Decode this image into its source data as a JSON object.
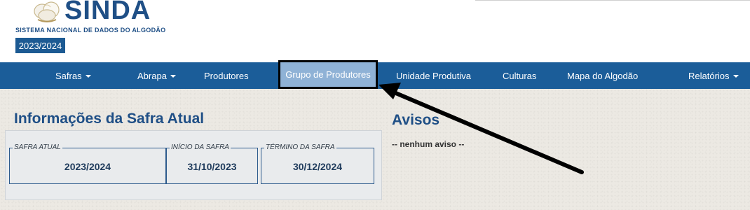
{
  "header": {
    "logo_name": "SINDA",
    "logo_tagline": "SISTEMA NACIONAL DE DADOS DO ALGODÃO",
    "safra_badge": "2023/2024"
  },
  "nav": {
    "items": [
      {
        "label": "Safras",
        "has_caret": true
      },
      {
        "label": "Abrapa",
        "has_caret": true
      },
      {
        "label": "Produtores",
        "has_caret": false
      },
      {
        "label": "Grupo de Produtores",
        "has_caret": false,
        "highlighted": true
      },
      {
        "label": "Unidade Produtiva",
        "has_caret": false
      },
      {
        "label": "Culturas",
        "has_caret": false
      },
      {
        "label": "Mapa do Algodão",
        "has_caret": false
      },
      {
        "label": "Relatórios",
        "has_caret": true
      }
    ]
  },
  "safra_info": {
    "title": "Informações da Safra Atual",
    "fields": [
      {
        "legend": "SAFRA ATUAL",
        "value": "2023/2024"
      },
      {
        "legend": "INÍCIO DA SAFRA",
        "value": "31/10/2023"
      },
      {
        "legend": "TÉRMINO DA SAFRA",
        "value": "30/12/2024"
      }
    ]
  },
  "avisos": {
    "title": "Avisos",
    "message": "-- nenhum aviso --"
  },
  "colors": {
    "nav_bg": "#1b5d99",
    "brand": "#1f4f86",
    "highlight_bg": "#8fb2d6"
  },
  "icons": {
    "logo": "cotton-boll-icon",
    "caret": "caret-down-icon",
    "annotation": "pointer-arrow-icon"
  }
}
